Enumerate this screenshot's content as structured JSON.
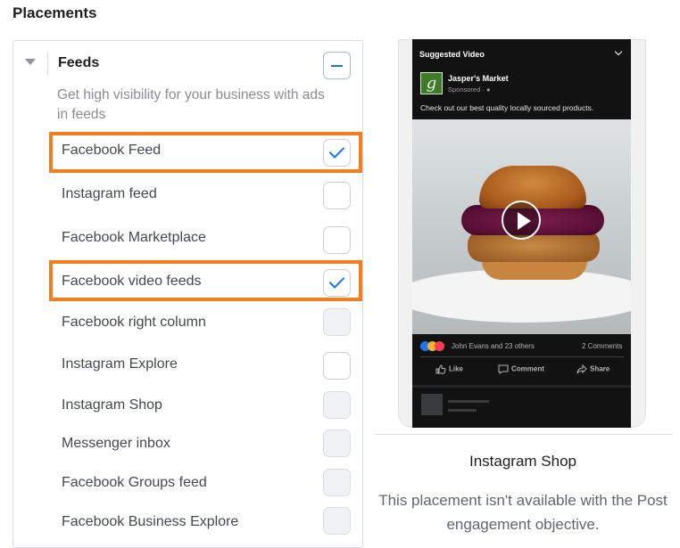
{
  "page": {
    "title": "Placements"
  },
  "feeds": {
    "label": "Feeds",
    "description": "Get high visibility for your business with ads in feeds",
    "items": [
      {
        "label": "Facebook Feed",
        "state": "checked",
        "highlighted": true
      },
      {
        "label": "Instagram feed",
        "state": "unchecked",
        "highlighted": false
      },
      {
        "label": "Facebook Marketplace",
        "state": "unchecked",
        "highlighted": false
      },
      {
        "label": "Facebook video feeds",
        "state": "checked",
        "highlighted": true
      },
      {
        "label": "Facebook right column",
        "state": "disabled",
        "highlighted": false
      },
      {
        "label": "Instagram Explore",
        "state": "unchecked",
        "highlighted": false
      },
      {
        "label": "Instagram Shop",
        "state": "disabled",
        "highlighted": false
      },
      {
        "label": "Messenger inbox",
        "state": "disabled",
        "highlighted": false
      },
      {
        "label": "Facebook Groups feed",
        "state": "disabled",
        "highlighted": false
      },
      {
        "label": "Facebook Business Explore",
        "state": "disabled",
        "highlighted": false
      }
    ]
  },
  "preview": {
    "header": "Suggested Video",
    "page_name": "Jasper's Market",
    "sponsored": "Sponsored · ",
    "logo_letter": "g",
    "post_text": "Check out our best quality locally sourced products.",
    "reactions_text": "John Evans and 23 others",
    "comments_count": "2 Comments",
    "actions": {
      "like": "Like",
      "comment": "Comment",
      "share": "Share"
    },
    "placement_title": "Instagram Shop",
    "placement_note": "This placement isn't available with the Post engagement objective."
  },
  "colors": {
    "accent": "#1877f2",
    "highlight": "#f47d20",
    "preview_bg": "#121212"
  }
}
